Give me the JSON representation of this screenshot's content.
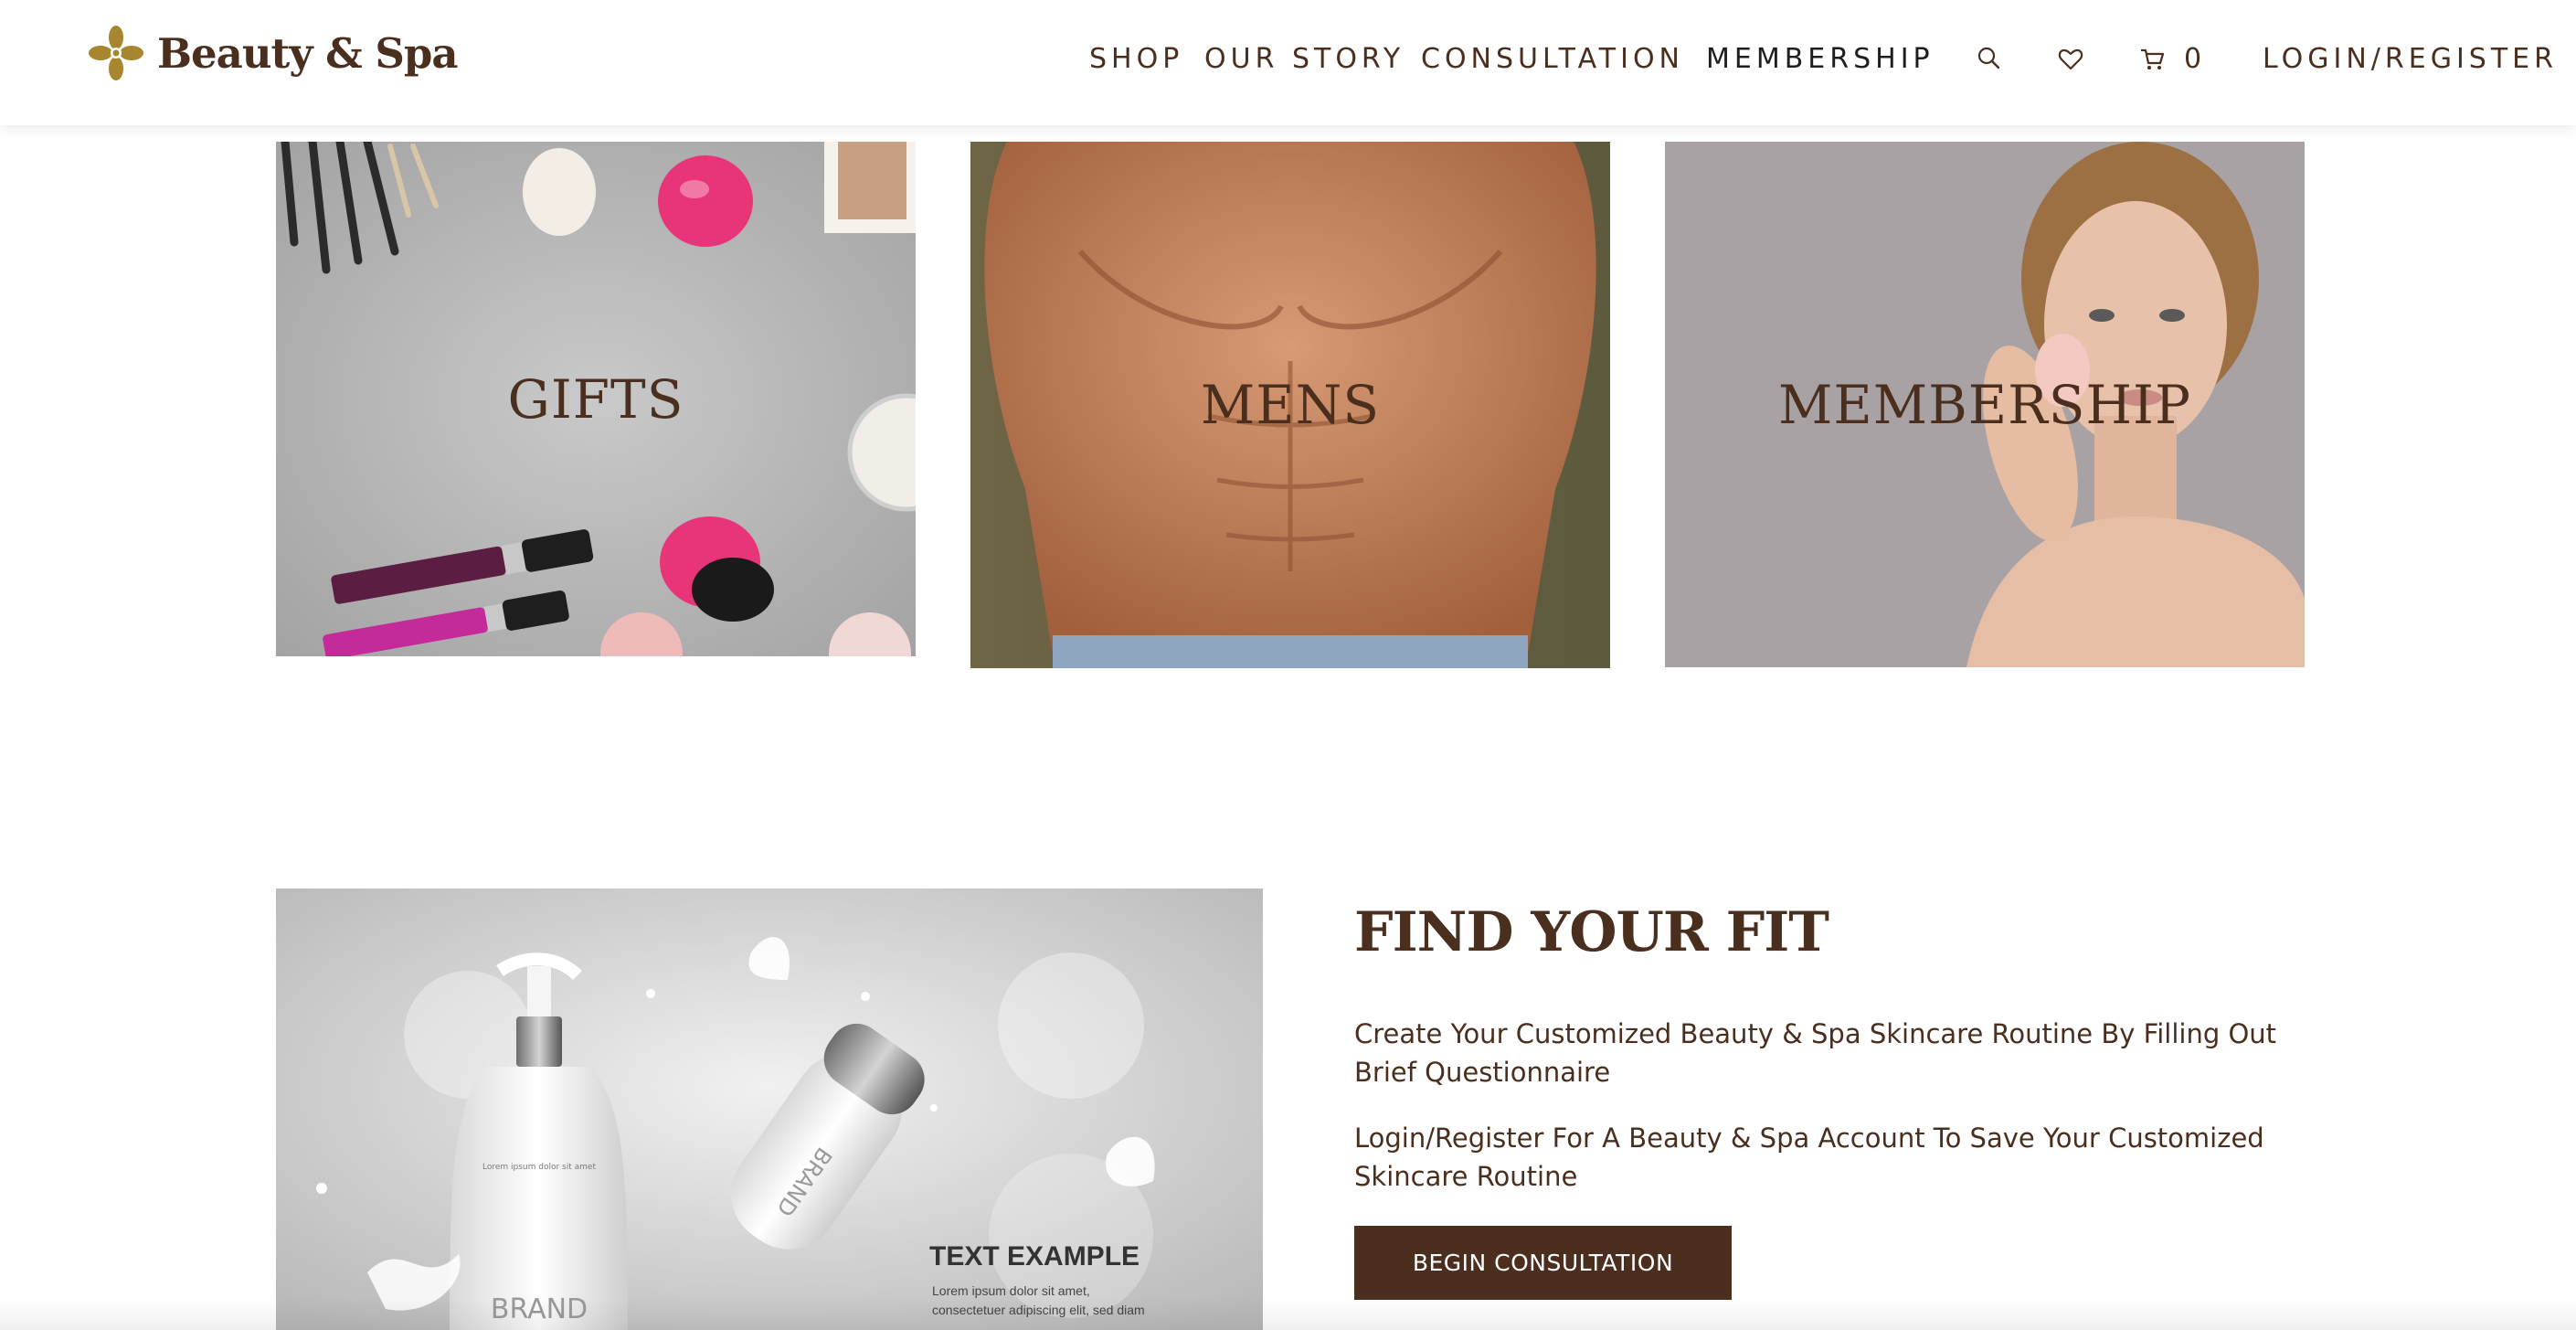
{
  "brand": {
    "name": "Beauty & Spa",
    "logo_icon": "flower-icon",
    "color": "#4a2f1f",
    "gold": "#a8852f"
  },
  "nav": {
    "items": [
      "SHOP",
      "OUR STORY",
      "CONSULTATION",
      "MEMBERSHIP"
    ],
    "active": "MEMBERSHIP",
    "search_icon": "search-icon",
    "wishlist_icon": "heart-icon",
    "cart_icon": "cart-icon",
    "cart_count": "0",
    "login_label": "LOGIN/REGISTER"
  },
  "categories": [
    {
      "label": "GIFTS",
      "image": "makeup-flatlay"
    },
    {
      "label": "MENS",
      "image": "male-torso"
    },
    {
      "label": "MEMBERSHIP",
      "image": "woman-skincare"
    }
  ],
  "find_fit": {
    "title": "FIND YOUR FIT",
    "paragraph1": "Create Your Customized Beauty & Spa Skincare Routine By Filling Out Brief Questionnaire",
    "paragraph2": "Login/Register For A Beauty & Spa Account To Save Your Customized Skincare Routine",
    "button_label": "BEGIN CONSULTATION",
    "button_color": "#4b2e1e"
  },
  "promo_image": {
    "brand_text": "BRAND",
    "bottle_brand_text": "BRAND",
    "headline": "TEXT EXAMPLE",
    "body_line1": "Lorem ipsum dolor sit amet,",
    "body_line2": "consectetuer adipiscing elit, sed diam",
    "bottle_small_text": "Lorem ipsum dolor sit amet"
  }
}
